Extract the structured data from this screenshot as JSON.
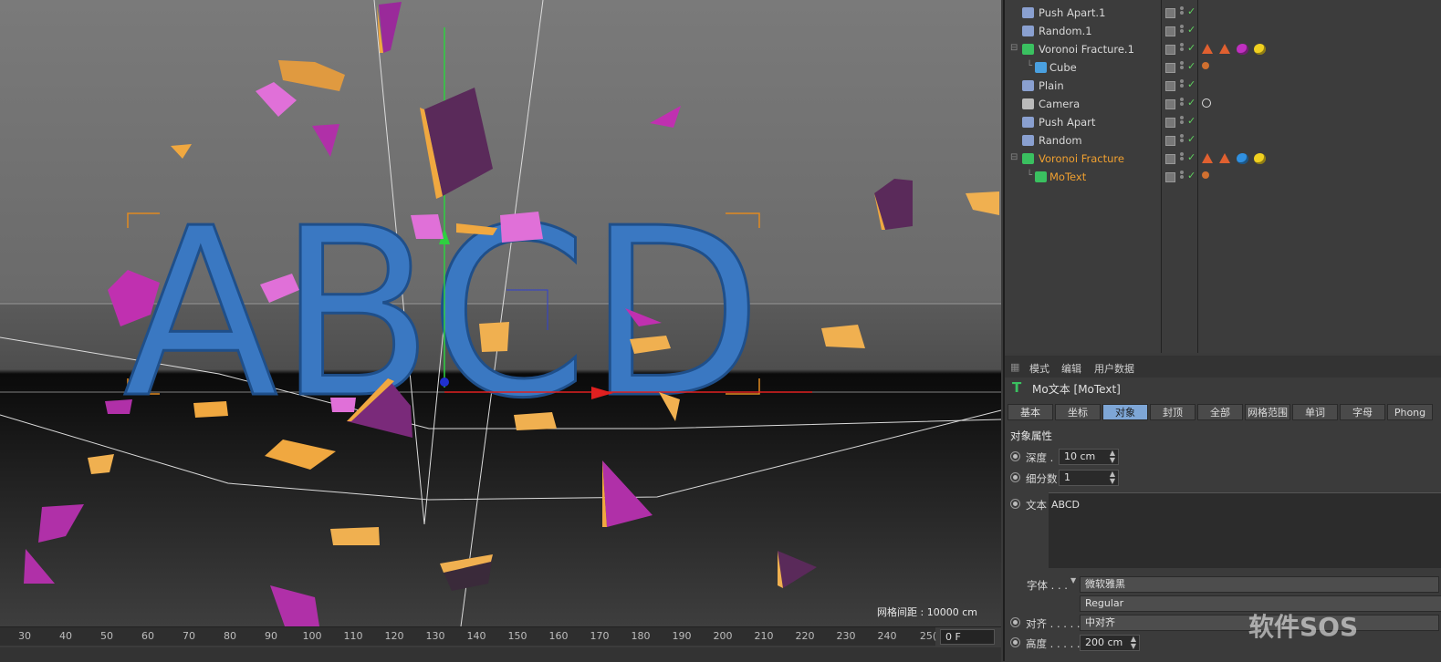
{
  "viewport": {
    "main_text": "ABCD",
    "grid_spacing_label": "网格间距 : 10000 cm",
    "colors": {
      "letters": "#3a78c2",
      "shard_face": "#c040b8",
      "shard_edge": "#f0a840",
      "axis_y": "#2fd040",
      "axis_x": "#e02020"
    }
  },
  "timeline": {
    "ticks": [
      "30",
      "40",
      "50",
      "60",
      "70",
      "80",
      "90",
      "100",
      "110",
      "120",
      "130",
      "140",
      "150",
      "160",
      "170",
      "180",
      "190",
      "200",
      "210",
      "220",
      "230",
      "240",
      "25("
    ],
    "current_frame": "0 F"
  },
  "objects": [
    {
      "name": "Push Apart.1",
      "icon": "push-apart-icon",
      "color": "#8aa0d0",
      "tree": "",
      "tags": []
    },
    {
      "name": "Random.1",
      "icon": "random-effector-icon",
      "color": "#8aa0d0",
      "tree": "",
      "tags": []
    },
    {
      "name": "Voronoi Fracture.1",
      "icon": "voronoi-icon",
      "color": "#3ac060",
      "tree": "⊟",
      "tags": [
        "tri-orange",
        "tri-orange",
        "ball-magenta",
        "ball-yellow"
      ]
    },
    {
      "name": "Cube",
      "icon": "cube-icon",
      "color": "#4aa0e0",
      "tree": "└",
      "tags": [
        "dots-orange"
      ]
    },
    {
      "name": "Plain",
      "icon": "plain-effector-icon",
      "color": "#8aa0d0",
      "tree": "",
      "tags": []
    },
    {
      "name": "Camera",
      "icon": "camera-icon",
      "color": "#bbbbbb",
      "tree": "",
      "tags": [
        "target"
      ]
    },
    {
      "name": "Push Apart",
      "icon": "push-apart-icon",
      "color": "#8aa0d0",
      "tree": "",
      "tags": []
    },
    {
      "name": "Random",
      "icon": "random-effector-icon",
      "color": "#8aa0d0",
      "tree": "",
      "tags": []
    },
    {
      "name": "Voronoi Fracture",
      "icon": "voronoi-icon",
      "color": "#3ac060",
      "tree": "⊟",
      "tags": [
        "tri-orange",
        "tri-orange",
        "ball-blue",
        "ball-yellow"
      ],
      "highlight": true
    },
    {
      "name": "MoText",
      "icon": "motext-icon",
      "color": "#3ac060",
      "tree": "└",
      "tags": [
        "dots-orange"
      ],
      "highlight": true
    }
  ],
  "attributes": {
    "menu": [
      "模式",
      "编辑",
      "用户数据"
    ],
    "title": "Mo文本 [MoText]",
    "tabs": [
      "基本",
      "坐标",
      "对象",
      "封顶",
      "全部",
      "网格范围",
      "单词",
      "字母",
      "Phong"
    ],
    "active_tab": "对象",
    "section": "对象属性",
    "depth_label": "深度 .",
    "depth_value": "10 cm",
    "subdiv_label": "细分数",
    "subdiv_value": "1",
    "text_label": "文本",
    "text_value": "ABCD",
    "font_label": "字体 . . .",
    "font_value": "微软雅黑",
    "style_value": "Regular",
    "align_label": "对齐 . . . . .",
    "align_value": "中对齐",
    "height_label": "高度 . . . . .",
    "height_value": "200 cm"
  },
  "watermark": "软件SOS"
}
